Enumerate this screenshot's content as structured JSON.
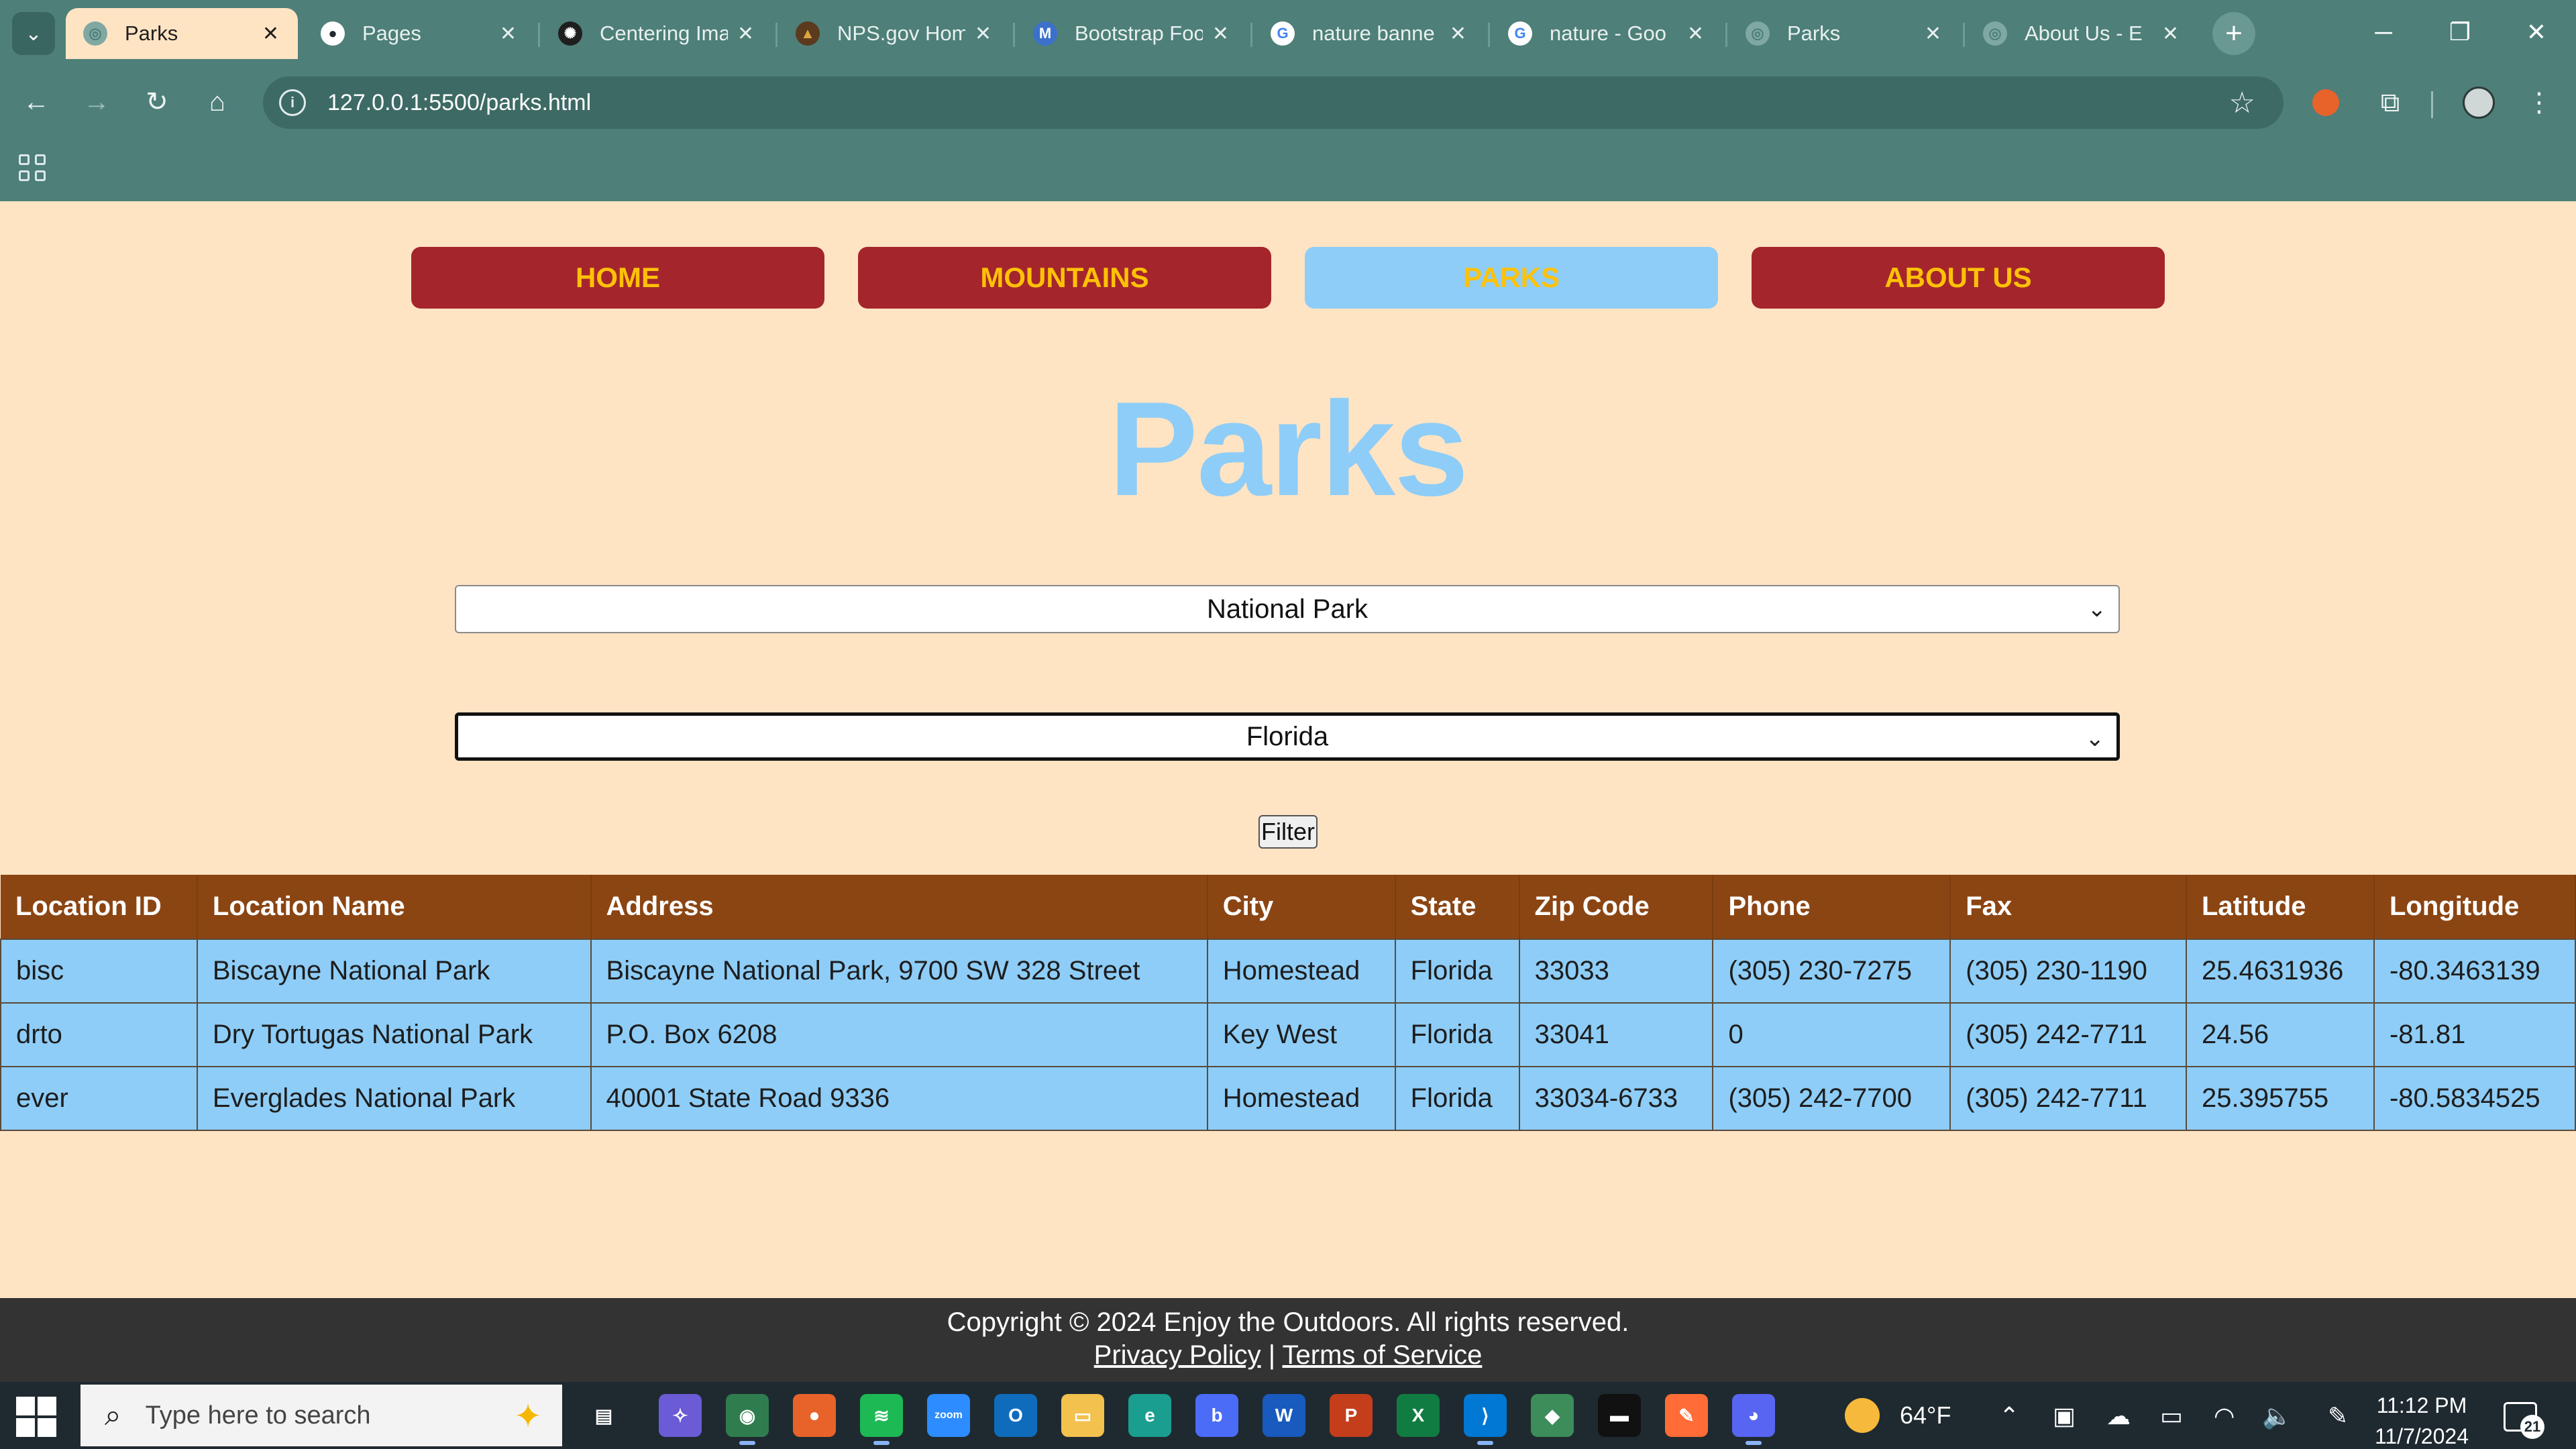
{
  "browser": {
    "tabs": [
      {
        "title": "Parks",
        "favicon": "globe-icon",
        "active": true
      },
      {
        "title": "Pages",
        "favicon": "github-icon",
        "active": false
      },
      {
        "title": "Centering Ima",
        "favicon": "openai-icon",
        "active": false
      },
      {
        "title": "NPS.gov Hom",
        "favicon": "nps-arrowhead-icon",
        "active": false
      },
      {
        "title": "Bootstrap Foo",
        "favicon": "mdb-icon",
        "active": false
      },
      {
        "title": "nature banne",
        "favicon": "google-icon",
        "active": false
      },
      {
        "title": "nature - Goo",
        "favicon": "google-icon",
        "active": false
      },
      {
        "title": "Parks",
        "favicon": "globe-icon",
        "active": false
      },
      {
        "title": "About Us - E",
        "favicon": "globe-icon",
        "active": false
      }
    ],
    "close_glyph": "✕",
    "new_tab_glyph": "+",
    "url": "127.0.0.1:5500/parks.html",
    "theme_color": "#4e7f79"
  },
  "nav": {
    "items": [
      "HOME",
      "MOUNTAINS",
      "PARKS",
      "ABOUT US"
    ],
    "active_index": 2,
    "button_color": "#a4262c",
    "active_color": "#8ecdf7",
    "text_color": "#ffc107"
  },
  "page": {
    "title": "Parks",
    "background": "#ffe4c4"
  },
  "filters": {
    "type_value": "National Park",
    "state_value": "Florida",
    "button_label": "Filter"
  },
  "table": {
    "headers": [
      "Location ID",
      "Location Name",
      "Address",
      "City",
      "State",
      "Zip Code",
      "Phone",
      "Fax",
      "Latitude",
      "Longitude"
    ],
    "rows": [
      [
        "bisc",
        "Biscayne National Park",
        "Biscayne National Park, 9700 SW 328 Street",
        "Homestead",
        "Florida",
        "33033",
        "(305) 230-7275",
        "(305) 230-1190",
        "25.4631936",
        "-80.3463139"
      ],
      [
        "drto",
        "Dry Tortugas National Park",
        "P.O. Box 6208",
        "Key West",
        "Florida",
        "33041",
        "0",
        "(305) 242-7711",
        "24.56",
        "-81.81"
      ],
      [
        "ever",
        "Everglades National Park",
        "40001 State Road 9336",
        "Homestead",
        "Florida",
        "33034-6733",
        "(305) 242-7700",
        "(305) 242-7711",
        "25.395755",
        "-80.5834525"
      ]
    ],
    "header_color": "#8b4513",
    "row_color": "#8ecdf7"
  },
  "footer": {
    "copyright": "Copyright © 2024 Enjoy the Outdoors. All rights reserved.",
    "privacy": "Privacy Policy",
    "separator": "|",
    "terms": "Terms of Service"
  },
  "taskbar": {
    "search_placeholder": "Type here to search",
    "apps": [
      "task-view",
      "copilot",
      "chrome",
      "firefox",
      "spotify",
      "zoom",
      "outlook",
      "file-explorer",
      "edge",
      "bing",
      "word",
      "powerpoint",
      "excel",
      "vscode",
      "git",
      "terminal",
      "postman",
      "discord"
    ],
    "weather": "64°F",
    "time": "11:12 PM",
    "date": "11/7/2024",
    "notifications": "21"
  }
}
